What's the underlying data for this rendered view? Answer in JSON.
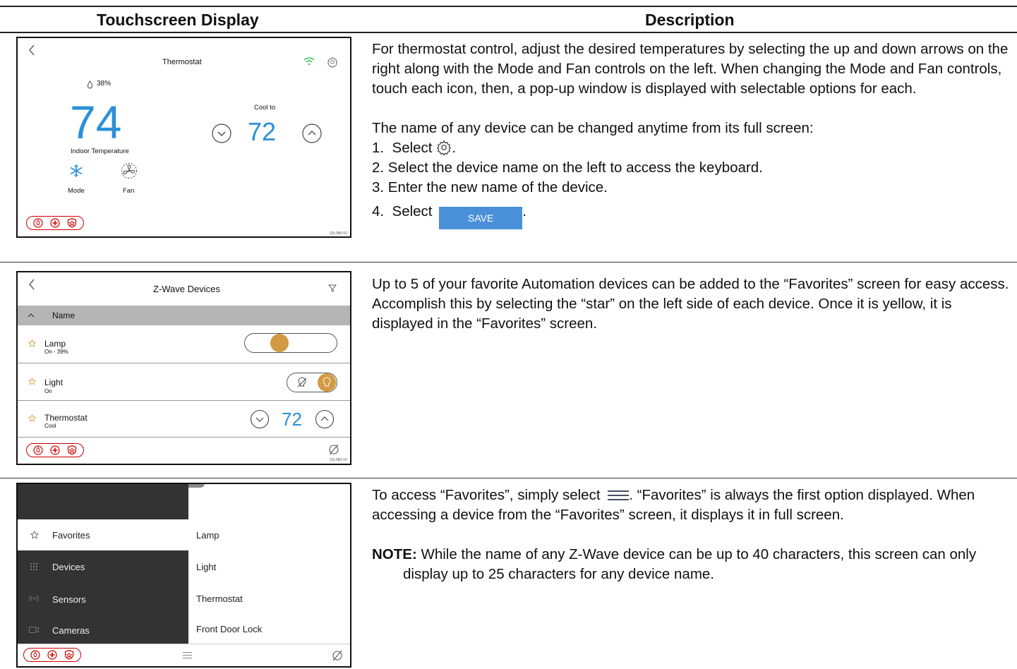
{
  "header": {
    "display": "Touchscreen Display",
    "description": "Description"
  },
  "colors": {
    "accent_blue": "#2a90d8",
    "amber": "#d29a42",
    "emergency_red": "#cc0000",
    "save_blue": "#4a90d9",
    "dark_menu": "#333333"
  },
  "rows": [
    {
      "screen": {
        "title": "Thermostat",
        "humidity": "38%",
        "indoor_temp": "74",
        "indoor_label": "Indoor Temperature",
        "cool_label": "Cool to",
        "setpoint": "72",
        "mode_label": "Mode",
        "fan_label": "Fan",
        "version": "QS-080-V0",
        "icons": [
          "back-chevron-icon",
          "wifi-icon",
          "gear-icon",
          "humidity-drop-icon",
          "snowflake-icon",
          "fan-icon",
          "chevron-down-icon",
          "chevron-up-icon",
          "fire-icon",
          "medical-icon",
          "police-icon"
        ]
      },
      "desc": {
        "p1": "For thermostat control, adjust the desired temperatures by selecting the up and down arrows on the right along with the Mode and Fan controls on the left.  When changing the Mode and Fan controls, touch each icon, then, a pop-up window is displayed with selectable options for each.",
        "p2": "The name of any device can be changed anytime from its full screen:",
        "step1_num": "1.",
        "step1_text": "Select",
        "step2": "2.  Select the device name on the left to access the keyboard.",
        "step3": "3.  Enter the new name of the device.",
        "step4_num": "4.",
        "step4_text": "Select",
        "save_label": "SAVE",
        "period": "."
      }
    },
    {
      "screen": {
        "title": "Z-Wave Devices",
        "sort_header": "Name",
        "devices": [
          {
            "name": "Lamp",
            "status": "On - 39%"
          },
          {
            "name": "Light",
            "status": "On"
          },
          {
            "name": "Thermostat",
            "status": "Cool",
            "setpoint": "72"
          }
        ],
        "version": "QS-085-V0"
      },
      "desc": {
        "p1": "Up to 5 of your favorite Automation devices can be added to the “Favorites” screen for easy access.  Accomplish this by selecting the “star” on the left side of each device.  Once it is yellow, it is displayed in the “Favorites” screen."
      }
    },
    {
      "screen": {
        "menu": [
          {
            "label": "Favorites",
            "icon": "star-icon"
          },
          {
            "label": "Devices",
            "icon": "grid-icon"
          },
          {
            "label": "Sensors",
            "icon": "sensor-icon"
          },
          {
            "label": "Cameras",
            "icon": "camera-icon"
          }
        ],
        "favorites": [
          "Lamp",
          "Light",
          "Thermostat",
          "Front Door Lock"
        ]
      },
      "desc": {
        "p1_a": "To access “Favorites”, simply select",
        "p1_b": ".  “Favorites” is always the first option displayed.  When accessing a device from the “Favorites” screen, it displays it in full screen.",
        "note_label": "NOTE:",
        "note_text": " While the name of any Z-Wave device can be up to 40 characters, this screen can only display up to 25 characters for any device name."
      }
    }
  ]
}
